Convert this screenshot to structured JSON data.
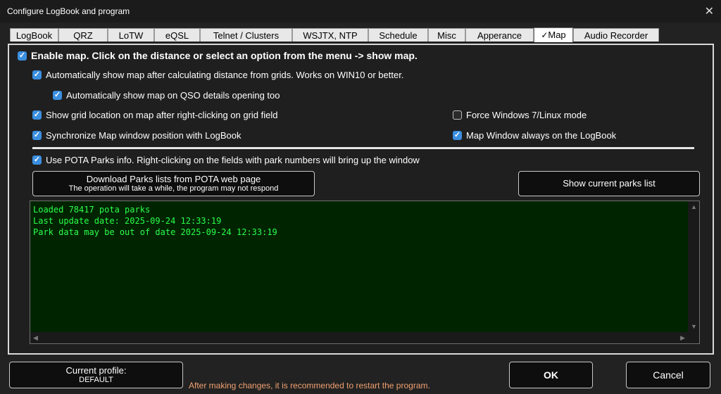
{
  "window": {
    "title": "Configure LogBook and program"
  },
  "tabs": [
    {
      "label": "LogBook"
    },
    {
      "label": "QRZ"
    },
    {
      "label": "LoTW"
    },
    {
      "label": "eQSL"
    },
    {
      "label": "Telnet / Clusters"
    },
    {
      "label": "WSJTX, NTP"
    },
    {
      "label": "Schedule"
    },
    {
      "label": "Misc"
    },
    {
      "label": "Apperance"
    },
    {
      "label": "Map",
      "active": true
    },
    {
      "label": "Audio Recorder"
    }
  ],
  "options": {
    "enable_map": {
      "label": "Enable map. Click on the distance or select an option from the menu -> show map.",
      "checked": true
    },
    "auto_show_grids": {
      "label": "Automatically show map after calculating distance from grids. Works on WIN10 or better.",
      "checked": true
    },
    "auto_show_qso": {
      "label": "Automatically show map on QSO details opening too",
      "checked": true
    },
    "show_grid_location": {
      "label": "Show grid location on map after right-clicking on grid field",
      "checked": true
    },
    "sync_position": {
      "label": "Synchronize Map window position with LogBook",
      "checked": true
    },
    "force_win7": {
      "label": "Force Windows 7/Linux mode",
      "checked": false
    },
    "always_on_logbook": {
      "label": "Map Window always on the LogBook",
      "checked": true
    },
    "use_pota": {
      "label": "Use POTA Parks info. Right-clicking on the fields with park numbers will bring up the window",
      "checked": true
    }
  },
  "buttons": {
    "download_parks": {
      "line1": "Download Parks lists from POTA web page",
      "line2": "The operation will take a while, the program may not respond"
    },
    "show_parks": {
      "label": "Show current parks list"
    },
    "profile": {
      "line1": "Current profile:",
      "line2": "DEFAULT"
    },
    "ok": {
      "label": "OK"
    },
    "cancel": {
      "label": "Cancel"
    }
  },
  "console": {
    "lines": [
      "Loaded 78417 pota parks",
      "Last update date: 2025-09-24 12:33:19",
      "Park data may be out of date 2025-09-24 12:33:19"
    ]
  },
  "footer": {
    "note": "After making changes, it is recommended to restart the program."
  },
  "colors": {
    "accent": "#3b8fe0",
    "console_text": "#2bff4a",
    "console_bg": "#002400",
    "note": "#f0a070"
  },
  "icons": {
    "close": "close-icon",
    "check": "checkmark-icon"
  }
}
